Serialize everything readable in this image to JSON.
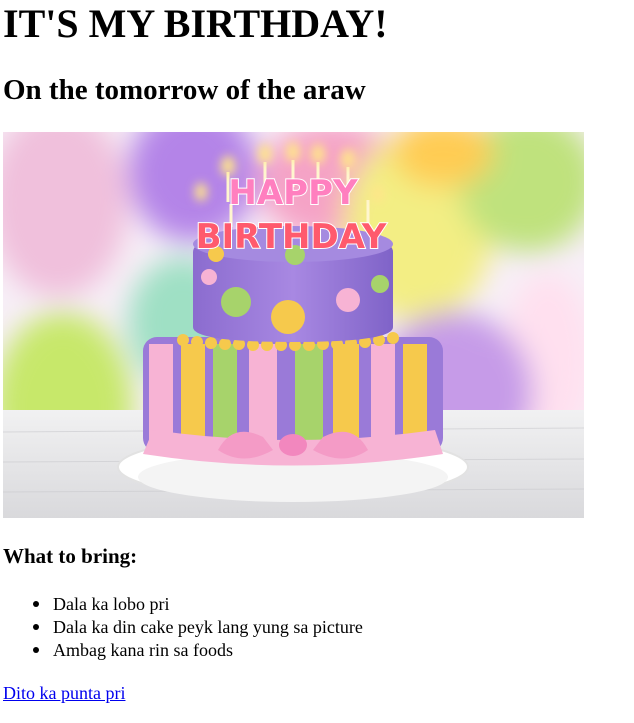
{
  "page": {
    "title": "IT'S MY BIRTHDAY!",
    "subtitle": "On the tomorrow of the araw"
  },
  "hero_image": {
    "cake_topper_line1": "HAPPY",
    "cake_topper_line2": "BIRTHDAY",
    "colors": {
      "cake_purple": "#9b7ad8",
      "cake_pink": "#f3a9cf",
      "cake_yellow": "#f6c94c",
      "cake_green": "#a7d36b",
      "plate": "#fbfbfb",
      "table": "#e8e8e8"
    }
  },
  "bring_section": {
    "heading": "What to bring:",
    "items": [
      "Dala ka lobo pri",
      "Dala ka din cake peyk lang yung sa picture",
      "Ambag kana rin sa foods"
    ]
  },
  "link": {
    "label": "Dito ka punta pri"
  }
}
